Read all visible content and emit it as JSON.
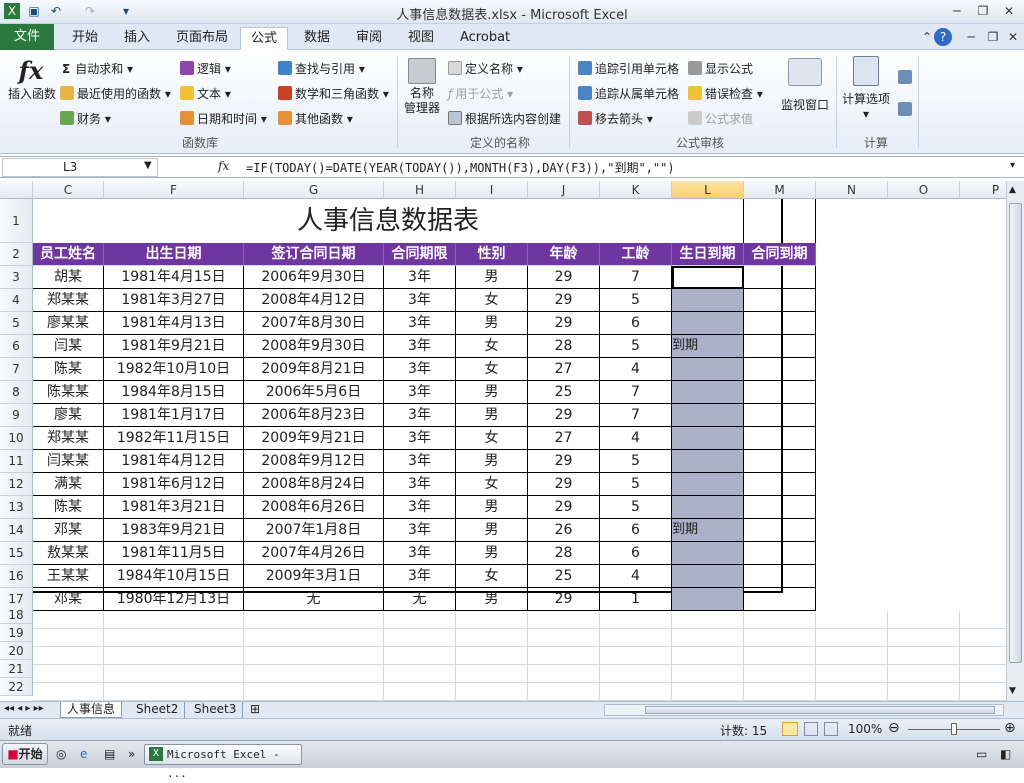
{
  "window": {
    "title": "人事信息数据表.xlsx - Microsoft Excel"
  },
  "tabs": [
    "文件",
    "开始",
    "插入",
    "页面布局",
    "公式",
    "数据",
    "审阅",
    "视图",
    "Acrobat"
  ],
  "active_tab": "公式",
  "ribbon": {
    "insert_function": "插入函数",
    "autosum": "自动求和",
    "recent": "最近使用的函数",
    "finance": "财务",
    "logic": "逻辑",
    "text": "文本",
    "datetime": "日期和时间",
    "lookup": "查找与引用",
    "math": "数学和三角函数",
    "other": "其他函数",
    "group_library": "函数库",
    "name_manager": "名称\n管理器",
    "define_name": "定义名称",
    "use_in_formula": "用于公式",
    "create_from_sel": "根据所选内容创建",
    "group_names": "定义的名称",
    "trace_prec": "追踪引用单元格",
    "trace_dep": "追踪从属单元格",
    "remove_arrows": "移去箭头",
    "show_formulas": "显示公式",
    "error_check": "错误检查",
    "eval_formula": "公式求值",
    "watch_window": "监视窗口",
    "group_audit": "公式审核",
    "calc_options": "计算选项",
    "group_calc": "计算"
  },
  "namebox": "L3",
  "formula": "=IF(TODAY()=DATE(YEAR(TODAY()),MONTH(F3),DAY(F3)),\"到期\",\"\")",
  "columns": [
    "C",
    "F",
    "G",
    "H",
    "I",
    "J",
    "K",
    "L",
    "M",
    "N",
    "O",
    "P"
  ],
  "rows": [
    "1",
    "2",
    "3",
    "4",
    "5",
    "6",
    "7",
    "8",
    "9",
    "10",
    "11",
    "12",
    "13",
    "14",
    "15",
    "16",
    "17",
    "18",
    "19",
    "20",
    "21",
    "22"
  ],
  "table_title": "人事信息数据表",
  "headers": [
    "员工姓名",
    "出生日期",
    "签订合同日期",
    "合同期限",
    "性别",
    "年龄",
    "工龄",
    "生日到期",
    "合同到期"
  ],
  "records": [
    [
      "胡某",
      "1981年4月15日",
      "2006年9月30日",
      "3年",
      "男",
      "29",
      "7",
      "",
      ""
    ],
    [
      "郑某某",
      "1981年3月27日",
      "2008年4月12日",
      "3年",
      "女",
      "29",
      "5",
      "",
      ""
    ],
    [
      "廖某某",
      "1981年4月13日",
      "2007年8月30日",
      "3年",
      "男",
      "29",
      "6",
      "",
      ""
    ],
    [
      "闫某",
      "1981年9月21日",
      "2008年9月30日",
      "3年",
      "女",
      "28",
      "5",
      "到期",
      ""
    ],
    [
      "陈某",
      "1982年10月10日",
      "2009年8月21日",
      "3年",
      "女",
      "27",
      "4",
      "",
      ""
    ],
    [
      "陈某某",
      "1984年8月15日",
      "2006年5月6日",
      "3年",
      "男",
      "25",
      "7",
      "",
      ""
    ],
    [
      "廖某",
      "1981年1月17日",
      "2006年8月23日",
      "3年",
      "男",
      "29",
      "7",
      "",
      ""
    ],
    [
      "郑某某",
      "1982年11月15日",
      "2009年9月21日",
      "3年",
      "女",
      "27",
      "4",
      "",
      ""
    ],
    [
      "闫某某",
      "1981年4月12日",
      "2008年9月12日",
      "3年",
      "男",
      "29",
      "5",
      "",
      ""
    ],
    [
      "满某",
      "1981年6月12日",
      "2008年8月24日",
      "3年",
      "女",
      "29",
      "5",
      "",
      ""
    ],
    [
      "陈某",
      "1981年3月21日",
      "2008年6月26日",
      "3年",
      "男",
      "29",
      "5",
      "",
      ""
    ],
    [
      "邓某",
      "1983年9月21日",
      "2007年1月8日",
      "3年",
      "男",
      "26",
      "6",
      "到期",
      ""
    ],
    [
      "敖某某",
      "1981年11月5日",
      "2007年4月26日",
      "3年",
      "男",
      "28",
      "6",
      "",
      ""
    ],
    [
      "王某某",
      "1984年10月15日",
      "2009年3月1日",
      "3年",
      "女",
      "25",
      "4",
      "",
      ""
    ],
    [
      "邓某",
      "1980年12月13日",
      "无",
      "无",
      "男",
      "29",
      "1",
      "",
      ""
    ]
  ],
  "sheets": [
    "人事信息",
    "Sheet2",
    "Sheet3"
  ],
  "status": {
    "ready": "就绪",
    "count": "计数: 15",
    "zoom": "100%"
  },
  "taskbar": {
    "start": "开始",
    "app": "Microsoft Excel - ..."
  }
}
